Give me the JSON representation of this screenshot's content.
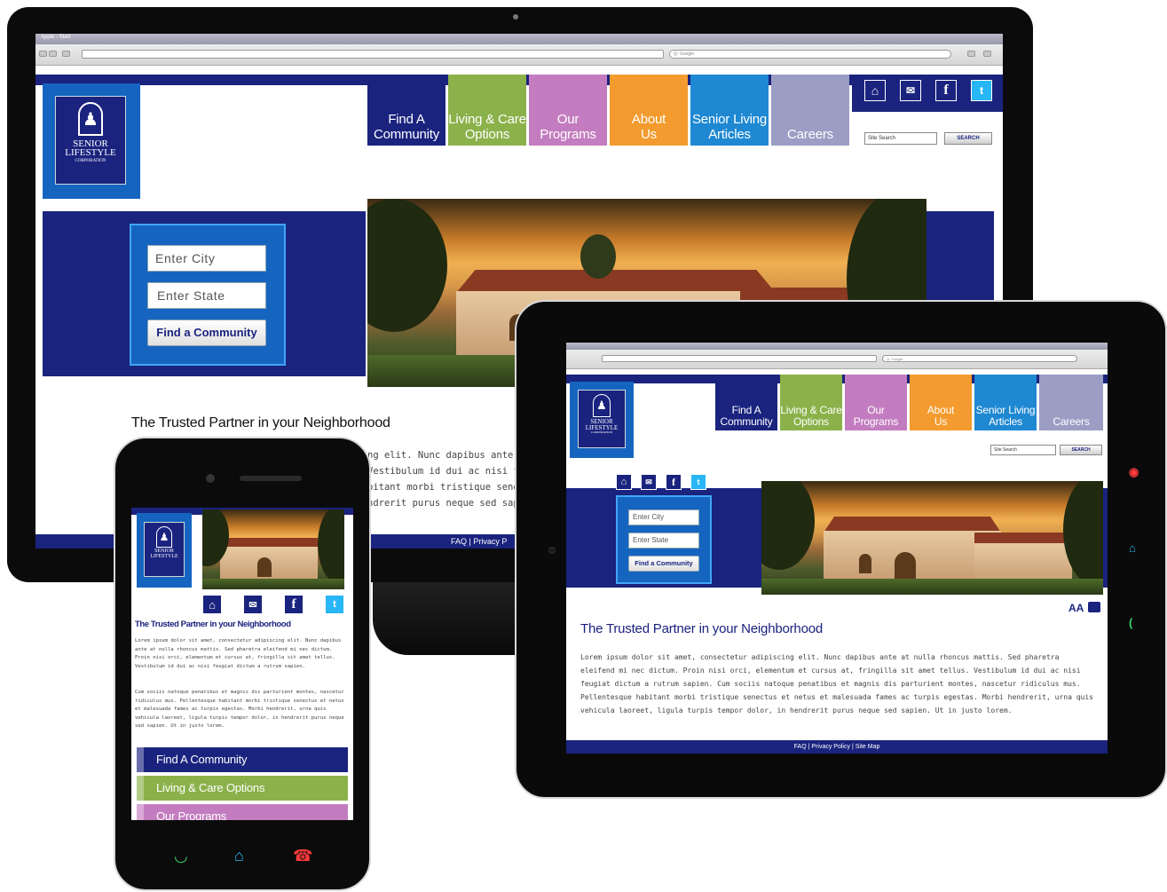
{
  "browser": {
    "window_title": "Apple - Start",
    "search_placeholder": "Q- Google"
  },
  "site": {
    "logo": {
      "line1": "SENIOR",
      "line2": "LIFESTYLE",
      "line3": "CORPORATION"
    },
    "nav": [
      {
        "line1": "Find A",
        "line2": "Community",
        "color": "#1a237e"
      },
      {
        "line1": "Living & Care",
        "line2": "Options",
        "color": "#8bb14a"
      },
      {
        "line1": "Our",
        "line2": "Programs",
        "color": "#c37cbf"
      },
      {
        "line1": "About",
        "line2": "Us",
        "color": "#f39b2e"
      },
      {
        "line1": "Senior Living",
        "line2": "Articles",
        "color": "#1e88d2"
      },
      {
        "line1": "",
        "line2": "Careers",
        "color": "#9b9dc4"
      }
    ],
    "social_icons": [
      "home-icon",
      "mail-icon",
      "facebook-icon",
      "twitter-icon"
    ],
    "site_search_placeholder": "Site Search",
    "search_button": "SEARCH",
    "form": {
      "city_placeholder": "Enter City",
      "state_placeholder": "Enter State",
      "button": "Find a Community"
    },
    "tagline": "The Trusted Partner in your Neighborhood",
    "body_paragraph": "Lorem ipsum dolor sit amet, consectetur adipiscing elit. Nunc dapibus ante at nulla rhoncus mattis. Sed pharetra eleifend mi nec dictum. Proin nisi orci, elementum et cursus at, fringilla sit amet tellus. Vestibulum id dui ac nisi feugiat dictum a rutrum sapien. Cum sociis natoque penatibus et magnis dis parturient montes, nascetur ridiculus mus. Pellentesque habitant morbi tristique senectus et netus et malesuada fames ac turpis egestas. Morbi hendrerit, urna quis vehicula laoreet, ligula turpis tempor dolor, in hendrerit purus neque sed sapien. Ut in justo lorem.",
    "monitor_body_fragment": [
      "ng elit. Nunc dapibus ante at",
      "Vestibulum id dui ac nisi feug",
      "bitant morbi tristique senectu",
      "ndrerit purus neque sed sapi"
    ],
    "footer": {
      "faq": "FAQ",
      "privacy": "Privacy Policy",
      "sitemap": "Site Map",
      "sep": "|"
    },
    "monitor_footer": "FAQ | Privacy P",
    "text_tools": "AA",
    "phone_para1": "Lorem ipsum dolor sit amet, consectetur adipiscing elit. Nunc dapibus ante at nulla rhoncus mattis. Sed pharetra eleifend mi nec dictum. Proin nisi orci, elementum et cursus at, fringilla sit amet tellus. Vestibulum id dui ac nisi feugiat dictum a rutrum sapien.",
    "phone_para2": "Cum sociis natoque penatibus et magnis dis parturient montes, nascetur ridiculus mus. Pellentesque habitant morbi tristique senectus et netus et malesuada fames ac turpis egestas. Morbi hendrerit, urna quis vehicula laoreet, ligula turpis tempor dolor, in hendrerit purus neque sed sapien. Ut in justo lorem.",
    "phone_menu": [
      {
        "label": "Find A Community",
        "color": "#1a237e"
      },
      {
        "label": "Living & Care Options",
        "color": "#8bb14a"
      },
      {
        "label": "Our Programs",
        "color": "#c37cbf"
      }
    ]
  },
  "colors": {
    "navy": "#1a237e",
    "brand_blue": "#1565c0",
    "twitter": "#29b6f6"
  }
}
